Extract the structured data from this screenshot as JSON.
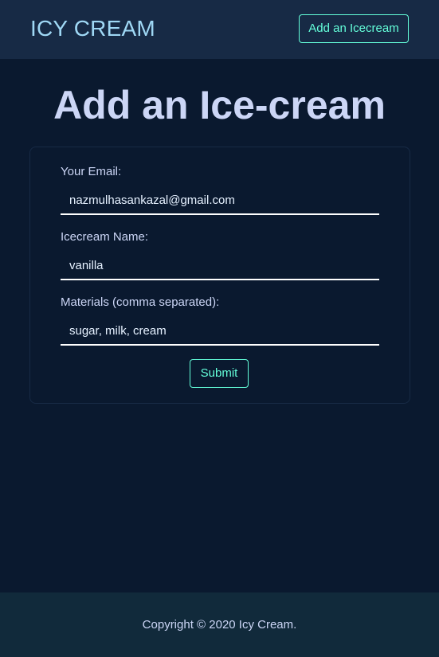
{
  "navbar": {
    "brand": "ICY CREAM",
    "add_button_label": "Add an Icecream"
  },
  "page": {
    "title": "Add an Ice-cream"
  },
  "form": {
    "email": {
      "label": "Your Email:",
      "value": "nazmulhasankazal@gmail.com"
    },
    "name": {
      "label": "Icecream Name:",
      "value": "vanilla"
    },
    "materials": {
      "label": "Materials (comma separated):",
      "value": "sugar, milk, cream"
    },
    "submit_label": "Submit"
  },
  "footer": {
    "copyright": "Copyright © 2020 Icy Cream."
  },
  "colors": {
    "background": "#0a192f",
    "navbar": "#172a45",
    "accent": "#64ffda",
    "brand": "#9fd8f5",
    "text": "#ccd6f6",
    "footer": "#112a3b"
  }
}
